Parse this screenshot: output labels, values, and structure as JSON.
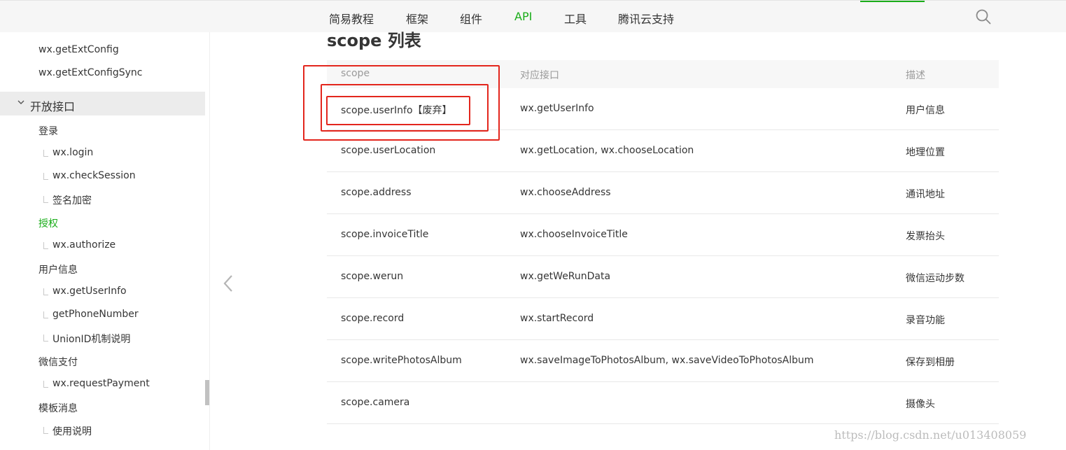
{
  "topnav": {
    "tabs": [
      {
        "label": "简易教程"
      },
      {
        "label": "框架"
      },
      {
        "label": "组件"
      },
      {
        "label": "API"
      },
      {
        "label": "工具"
      },
      {
        "label": "腾讯云支持"
      }
    ],
    "active_tab": "API",
    "search_icon": "search-icon"
  },
  "sidebar": {
    "items_top": [
      "wx.getExtConfig",
      "wx.getExtConfigSync"
    ],
    "section": {
      "label": "开放接口",
      "icon": "chevron-down-icon"
    },
    "items": [
      {
        "label": "登录"
      },
      {
        "label": "wx.login"
      },
      {
        "label": "wx.checkSession"
      },
      {
        "label": "签名加密"
      },
      {
        "label": "授权"
      },
      {
        "label": "wx.authorize"
      },
      {
        "label": "用户信息"
      },
      {
        "label": "wx.getUserInfo"
      },
      {
        "label": "getPhoneNumber"
      },
      {
        "label": "UnionID机制说明"
      },
      {
        "label": "微信支付"
      },
      {
        "label": "wx.requestPayment"
      },
      {
        "label": "模板消息"
      },
      {
        "label": "使用说明"
      }
    ],
    "active_item": "授权"
  },
  "content": {
    "title": "scope 列表",
    "table": {
      "headers": [
        "scope",
        "对应接口",
        "描述"
      ],
      "rows": [
        {
          "scope": "scope.userInfo【废弃】",
          "api": "wx.getUserInfo",
          "desc": "用户信息"
        },
        {
          "scope": "scope.userLocation",
          "api": "wx.getLocation, wx.chooseLocation",
          "desc": "地理位置"
        },
        {
          "scope": "scope.address",
          "api": "wx.chooseAddress",
          "desc": "通讯地址"
        },
        {
          "scope": "scope.invoiceTitle",
          "api": "wx.chooseInvoiceTitle",
          "desc": "发票抬头"
        },
        {
          "scope": "scope.werun",
          "api": "wx.getWeRunData",
          "desc": "微信运动步数"
        },
        {
          "scope": "scope.record",
          "api": "wx.startRecord",
          "desc": "录音功能"
        },
        {
          "scope": "scope.writePhotosAlbum",
          "api": "wx.saveImageToPhotosAlbum, wx.saveVideoToPhotosAlbum",
          "desc": "保存到相册"
        },
        {
          "scope": "scope.camera",
          "api": "",
          "desc": "摄像头"
        }
      ]
    }
  },
  "watermark": "https://blog.csdn.net/u013408059",
  "colors": {
    "accent": "#1aad19",
    "annotation": "#e3261d"
  }
}
